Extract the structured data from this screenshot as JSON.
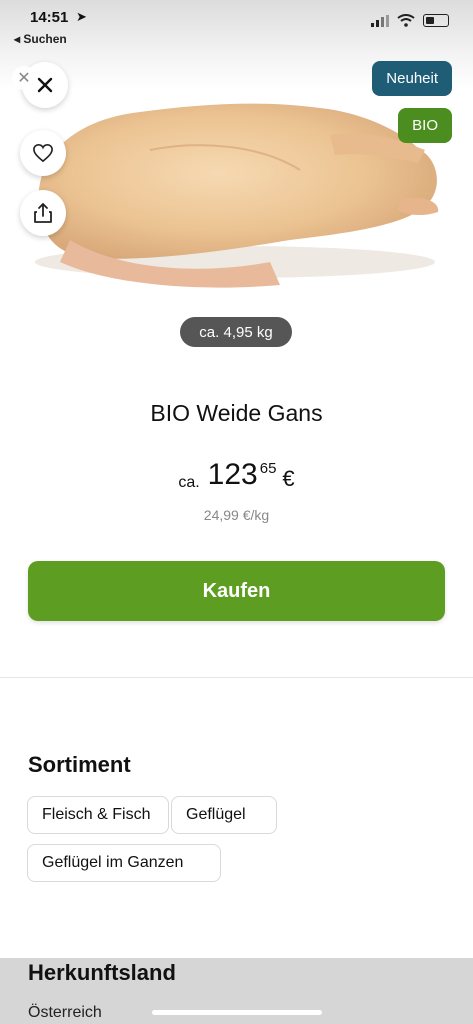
{
  "status": {
    "time": "14:51",
    "back_app": "◂ Suchen"
  },
  "badges": {
    "new": "Neuheit",
    "bio": "BIO"
  },
  "product": {
    "weight": "ca. 4,95 kg",
    "title": "BIO Weide Gans",
    "price_prefix": "ca.",
    "price_main": "123",
    "price_cents": "65",
    "currency": "€",
    "unit_price": "24,99 €/kg"
  },
  "actions": {
    "buy_label": "Kaufen"
  },
  "assortment": {
    "title": "Sortiment",
    "chips": [
      "Fleisch & Fisch",
      "Geflügel",
      "Geflügel im Ganzen"
    ]
  },
  "origin": {
    "title": "Herkunftsland",
    "value": "Österreich"
  },
  "colors": {
    "buy_green": "#5d9e22",
    "new_badge": "#1f5d76",
    "bio_badge": "#4c8d1f"
  },
  "icons": [
    "close-icon",
    "heart-icon",
    "share-icon",
    "location-arrow-icon",
    "signal-icon",
    "wifi-icon",
    "battery-icon"
  ]
}
